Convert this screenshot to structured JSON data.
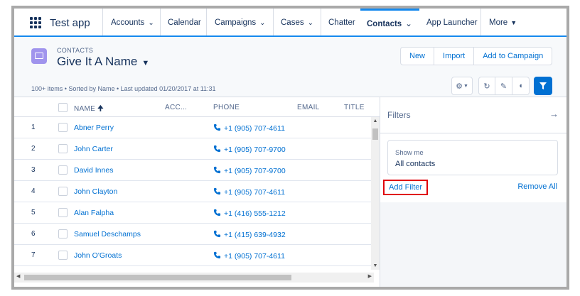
{
  "nav": {
    "app_name": "Test app",
    "items": [
      {
        "label": "Accounts",
        "has_chevron": true
      },
      {
        "label": "Calendar",
        "has_chevron": false
      },
      {
        "label": "Campaigns",
        "has_chevron": true
      },
      {
        "label": "Cases",
        "has_chevron": true
      },
      {
        "label": "Chatter",
        "has_chevron": false
      },
      {
        "label": "Contacts",
        "has_chevron": true,
        "active": true
      },
      {
        "label": "App Launcher",
        "has_chevron": false
      },
      {
        "label": "More",
        "has_chevron": true
      }
    ]
  },
  "header": {
    "object_label": "CONTACTS",
    "list_name": "Give It A Name",
    "meta": "100+ items • Sorted by Name • Last updated 01/20/2017 at 11:31",
    "buttons": [
      "New",
      "Import",
      "Add to Campaign"
    ]
  },
  "table": {
    "columns": [
      "NAME",
      "ACC...",
      "PHONE",
      "EMAIL",
      "TITLE"
    ],
    "rows": [
      {
        "num": "1",
        "name": "Abner Perry",
        "phone": "+1 (905) 707-4611"
      },
      {
        "num": "2",
        "name": "John Carter",
        "phone": "+1 (905) 707-9700"
      },
      {
        "num": "3",
        "name": "David Innes",
        "phone": "+1 (905) 707-9700"
      },
      {
        "num": "4",
        "name": "John Clayton",
        "phone": "+1 (905) 707-4611"
      },
      {
        "num": "5",
        "name": "Alan Falpha",
        "phone": "+1 (416) 555-1212"
      },
      {
        "num": "6",
        "name": "Samuel Deschamps",
        "phone": "+1 (415) 639-4932"
      },
      {
        "num": "7",
        "name": "John O'Groats",
        "phone": "+1 (905) 707-4611"
      }
    ]
  },
  "filters": {
    "title": "Filters",
    "show_me_label": "Show me",
    "show_me_value": "All contacts",
    "add_filter": "Add Filter",
    "remove_all": "Remove All"
  },
  "colors": {
    "brand": "#1589ee",
    "link": "#0070d2",
    "highlight": "#e0000b",
    "object_icon": "#a094ed"
  }
}
